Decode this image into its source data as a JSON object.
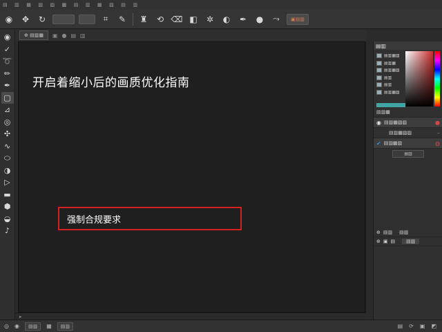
{
  "menubar": [
    "ⓞ",
    "▤",
    "▥",
    "▦",
    "▧",
    "▨",
    "▩",
    "▥",
    "▦",
    "▤",
    "▥",
    "▦",
    "▧",
    "▤",
    "▦"
  ],
  "toolbar": {
    "icons": [
      "eye-icon",
      "move-icon",
      "lasso-icon",
      "crop-icon",
      "brush-icon",
      "stamp-icon",
      "history-icon",
      "eraser-icon",
      "gradient-icon",
      "blur-icon",
      "dodge-icon",
      "pen-icon",
      "type-icon",
      "shape-icon"
    ],
    "button_label": ""
  },
  "tabs": {
    "doc_tab": ""
  },
  "canvas": {
    "title": "开启着缩小后的画质优化指南",
    "notice": "强制合规要求"
  },
  "right_panel": {
    "color_header": "",
    "layers_header": ""
  },
  "statusbar": {
    "zoom": "",
    "doc_info": ""
  }
}
